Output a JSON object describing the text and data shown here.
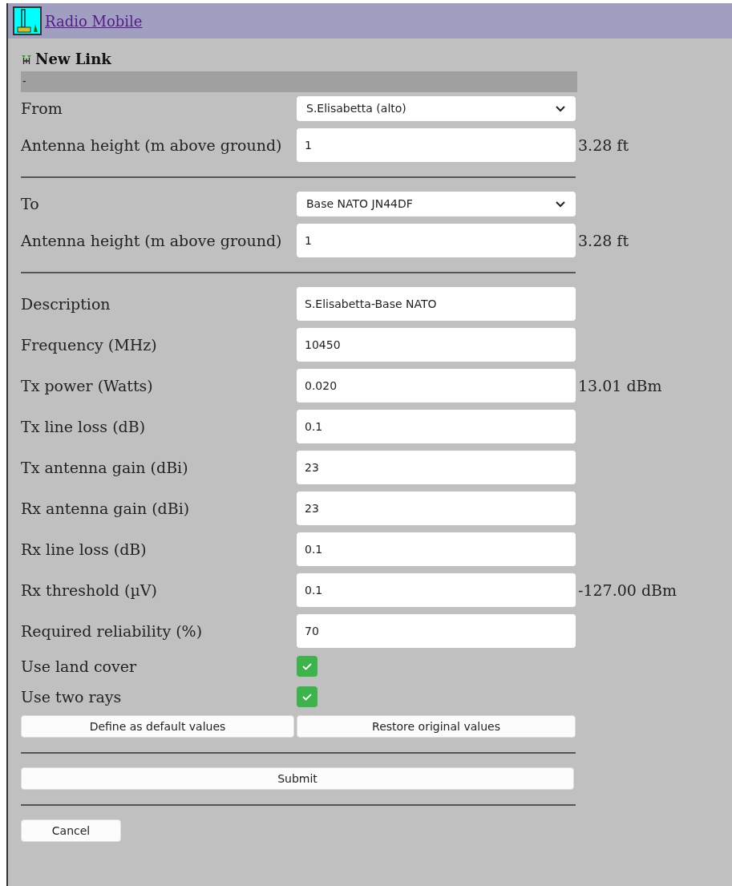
{
  "header": {
    "title": "Radio Mobile"
  },
  "heading": "New Link",
  "status_bar": "-",
  "sections": [
    {
      "rows": [
        {
          "kind": "select",
          "label": "From",
          "value": "S.Elisabetta (alto)"
        },
        {
          "kind": "input",
          "label": "Antenna height (m above ground)",
          "value": "1",
          "unit": "3.28 ft"
        }
      ]
    },
    {
      "rows": [
        {
          "kind": "select",
          "label": "To",
          "value": "Base NATO JN44DF"
        },
        {
          "kind": "input",
          "label": "Antenna height (m above ground)",
          "value": "1",
          "unit": "3.28 ft"
        }
      ]
    },
    {
      "rows": [
        {
          "kind": "input",
          "label": "Description",
          "value": "S.Elisabetta-Base NATO"
        },
        {
          "kind": "input",
          "label": "Frequency (MHz)",
          "value": "10450"
        },
        {
          "kind": "input",
          "label": "Tx power (Watts)",
          "value": "0.020",
          "unit": "13.01 dBm"
        },
        {
          "kind": "input",
          "label": "Tx line loss (dB)",
          "value": "0.1"
        },
        {
          "kind": "input",
          "label": "Tx antenna gain (dBi)",
          "value": "23"
        },
        {
          "kind": "input",
          "label": "Rx antenna gain (dBi)",
          "value": "23"
        },
        {
          "kind": "input",
          "label": "Rx line loss (dB)",
          "value": "0.1"
        },
        {
          "kind": "input",
          "label": "Rx threshold (µV)",
          "value": "0.1",
          "unit": "-127.00 dBm"
        },
        {
          "kind": "input",
          "label": "Required reliability (%)",
          "value": "70"
        },
        {
          "kind": "checkbox",
          "label": "Use land cover",
          "checked": true
        },
        {
          "kind": "checkbox",
          "label": "Use two rays",
          "checked": true
        }
      ],
      "buttons": [
        "Define as default values",
        "Restore original values"
      ]
    }
  ],
  "submit": "Submit",
  "cancel": "Cancel"
}
